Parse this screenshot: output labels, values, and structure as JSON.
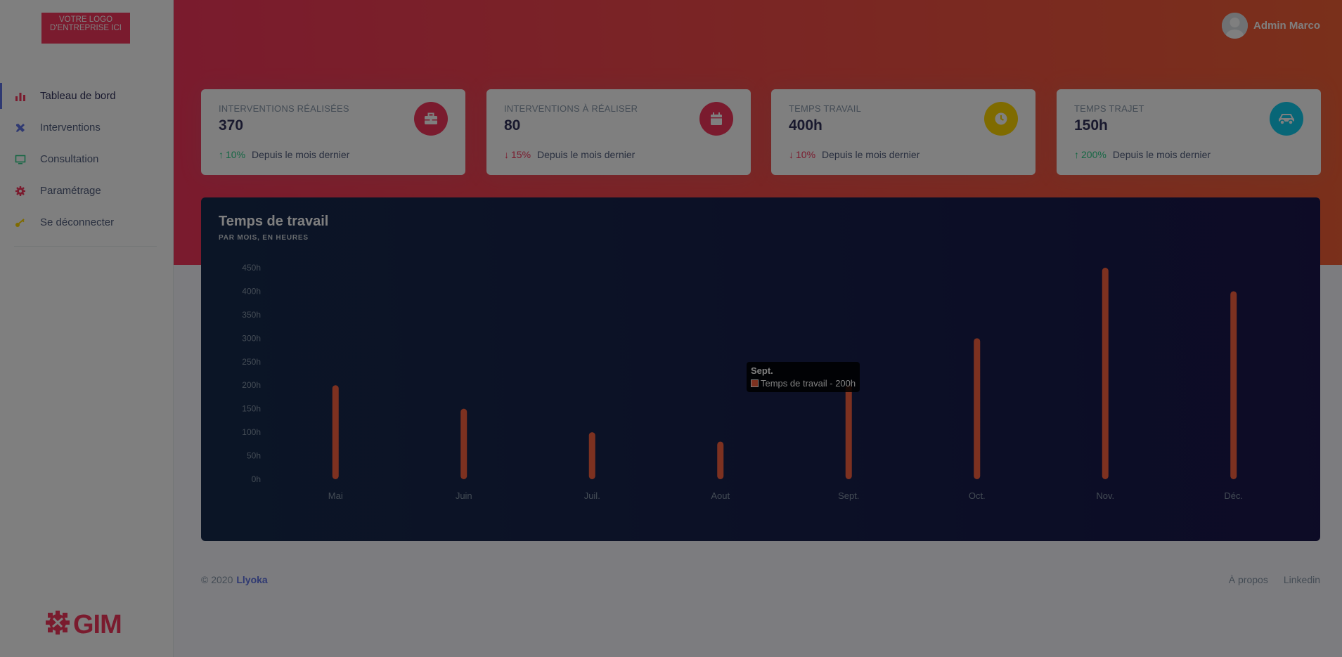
{
  "sidebar": {
    "logo_text": "VOTRE LOGO D'ENTREPRISE ICI",
    "items": [
      {
        "label": "Tableau de bord",
        "icon": "bar-chart-icon",
        "color": "#f5365c",
        "active": true
      },
      {
        "label": "Interventions",
        "icon": "tools-icon",
        "color": "#5e72e4",
        "active": false
      },
      {
        "label": "Consultation",
        "icon": "monitor-icon",
        "color": "#2dce89",
        "active": false
      },
      {
        "label": "Paramétrage",
        "icon": "gear-icon",
        "color": "#f5365c",
        "active": false
      },
      {
        "label": "Se déconnecter",
        "icon": "key-icon",
        "color": "#ffd600",
        "active": false
      }
    ],
    "brand_text": "GIM"
  },
  "header": {
    "user_name": "Admin Marco"
  },
  "cards": [
    {
      "title": "Interventions réalisées",
      "value": "370",
      "trend": "up",
      "percent": "10%",
      "since": "Depuis le mois dernier",
      "icon": "toolbox-icon",
      "icon_color": "#f5365c"
    },
    {
      "title": "Interventions à réaliser",
      "value": "80",
      "trend": "down",
      "percent": "15%",
      "since": "Depuis le mois dernier",
      "icon": "calendar-icon",
      "icon_color": "#f5365c"
    },
    {
      "title": "Temps travail",
      "value": "400h",
      "trend": "down",
      "percent": "10%",
      "since": "Depuis le mois dernier",
      "icon": "clock-icon",
      "icon_color": "#ffd600"
    },
    {
      "title": "Temps trajet",
      "value": "150h",
      "trend": "up",
      "percent": "200%",
      "since": "Depuis le mois dernier",
      "icon": "car-icon",
      "icon_color": "#11cdef"
    }
  ],
  "chart": {
    "title": "Temps de travail",
    "subtitle": "Par mois, en heures",
    "tooltip_title": "Sept.",
    "tooltip_text": "Temps de travail - 200h"
  },
  "chart_data": {
    "type": "bar",
    "title": "Temps de travail",
    "subtitle": "Par mois, en heures",
    "categories": [
      "Mai",
      "Juin",
      "Juil.",
      "Aout",
      "Sept.",
      "Oct.",
      "Nov.",
      "Déc."
    ],
    "series": [
      {
        "name": "Temps de travail",
        "values": [
          200,
          150,
          100,
          80,
          200,
          300,
          450,
          400
        ]
      }
    ],
    "ylim": [
      0,
      450
    ],
    "yticks": [
      "0h",
      "50h",
      "100h",
      "150h",
      "200h",
      "250h",
      "300h",
      "350h",
      "400h",
      "450h"
    ],
    "bar_color": "#fb6340",
    "grid": false
  },
  "footer": {
    "copyright": "© 2020",
    "brand": "Llyoka",
    "links": [
      "À propos",
      "Linkedin"
    ]
  }
}
